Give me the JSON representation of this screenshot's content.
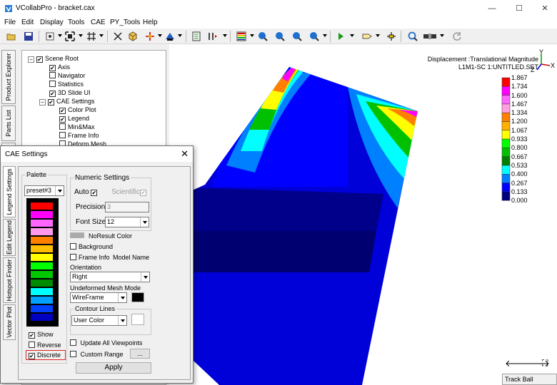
{
  "window": {
    "title": "VCollabPro - bracket.cax",
    "minimize": "—",
    "maximize": "☐",
    "close": "✕"
  },
  "menu": [
    "File",
    "Edit",
    "Display",
    "Tools",
    "CAE",
    "PY_Tools",
    "Help"
  ],
  "toolbar_icons": [
    "open-icon",
    "save-icon",
    "view-icon",
    "fit-icon",
    "grid-icon",
    "scale-icon",
    "cube-icon",
    "axis-icon",
    "render-icon",
    "clip-icon",
    "step-icon",
    "palette-icon",
    "zoom-in-icon",
    "zoom-out-icon",
    "zoom-box-icon",
    "play-icon",
    "label-icon",
    "probe-icon",
    "magnify-icon",
    "slide-icon",
    "refresh-icon"
  ],
  "left_tabs": [
    "Product Explorer",
    "Parts List",
    "nts"
  ],
  "tree": [
    {
      "label": "Scene Root",
      "level": 0,
      "checked": true,
      "expander": "−"
    },
    {
      "label": "Axis",
      "level": 1,
      "checked": true
    },
    {
      "label": "Navigator",
      "level": 1,
      "checked": false
    },
    {
      "label": "Statistics",
      "level": 1,
      "checked": false
    },
    {
      "label": "3D Slide UI",
      "level": 1,
      "checked": true
    },
    {
      "label": "CAE Settings",
      "level": 1,
      "checked": true,
      "expander": "−"
    },
    {
      "label": "Color Plot",
      "level": 2,
      "checked": true
    },
    {
      "label": "Legend",
      "level": 2,
      "checked": true
    },
    {
      "label": "Min&Max",
      "level": 2,
      "checked": false
    },
    {
      "label": "Frame Info",
      "level": 2,
      "checked": false
    },
    {
      "label": "Deform Mesh",
      "level": 2,
      "checked": false
    }
  ],
  "viewport": {
    "legend_title_1": "Displacement :Translational Magnitude",
    "legend_title_2": "L1M1-SC 1:UNTITLED.SET",
    "legend_values": [
      "1.867",
      "1.734",
      "1.600",
      "1.467",
      "1.334",
      "1.200",
      "1.067",
      "0.933",
      "0.800",
      "0.667",
      "0.533",
      "0.400",
      "0.267",
      "0.133",
      "0.000"
    ],
    "legend_colors": [
      "#ff0000",
      "#ff00ff",
      "#ff66ff",
      "#ff9fe0",
      "#ff7f00",
      "#ffb000",
      "#ffff00",
      "#00ff00",
      "#00c000",
      "#008000",
      "#00ffff",
      "#0080ff",
      "#0000ff",
      "#000080"
    ],
    "axis": {
      "x": "X",
      "y": "Y",
      "z": "Z"
    },
    "nav": {
      "left": "🡐",
      "right": "🡒",
      "expand": "⛶"
    },
    "status": "Track Ball"
  },
  "dialog": {
    "title": "CAE Settings",
    "close": "✕",
    "tabs": [
      "Legend Settings",
      "Edit Legend",
      "Hotspot Finder",
      "Vector Plot"
    ],
    "palette": {
      "group": "Palette",
      "preset": "preset#3",
      "colors": [
        "#ff0000",
        "#ff00ff",
        "#ff66ff",
        "#ff99ee",
        "#ff8000",
        "#ffbf00",
        "#ffff00",
        "#00ff00",
        "#00c800",
        "#008c00",
        "#00ffff",
        "#00a0ff",
        "#0040ff",
        "#0000c0"
      ],
      "show_label": "Show",
      "show_checked": "✔",
      "reverse_label": "Reverse",
      "discrete_label": "Discrete",
      "discrete_checked": "✔"
    },
    "numeric": {
      "group": "Numeric Settings",
      "auto_label": "Auto",
      "auto_checked": "✔",
      "scientific_label": "Scientific",
      "scientific_checked": "✔",
      "precision_label": "Precision",
      "precision_value": "3",
      "fontsize_label": "Font Size",
      "fontsize_value": "12"
    },
    "noresult_label": "NoResult Color",
    "background_label": "Background",
    "frameinfo_label": "Frame Info",
    "modelname_label": "Model Name",
    "orientation_label": "Orientation",
    "orientation_value": "Right",
    "undeformed_label": "Undeformed Mesh Mode",
    "undeformed_value": "WireFrame",
    "contour_group": "Contour Lines",
    "contour_value": "User Color",
    "update_label": "Update All Viewpoints",
    "customrange_label": "Custom Range",
    "ellipsis": "...",
    "apply": "Apply",
    "highlight_color": "#e0201c"
  }
}
